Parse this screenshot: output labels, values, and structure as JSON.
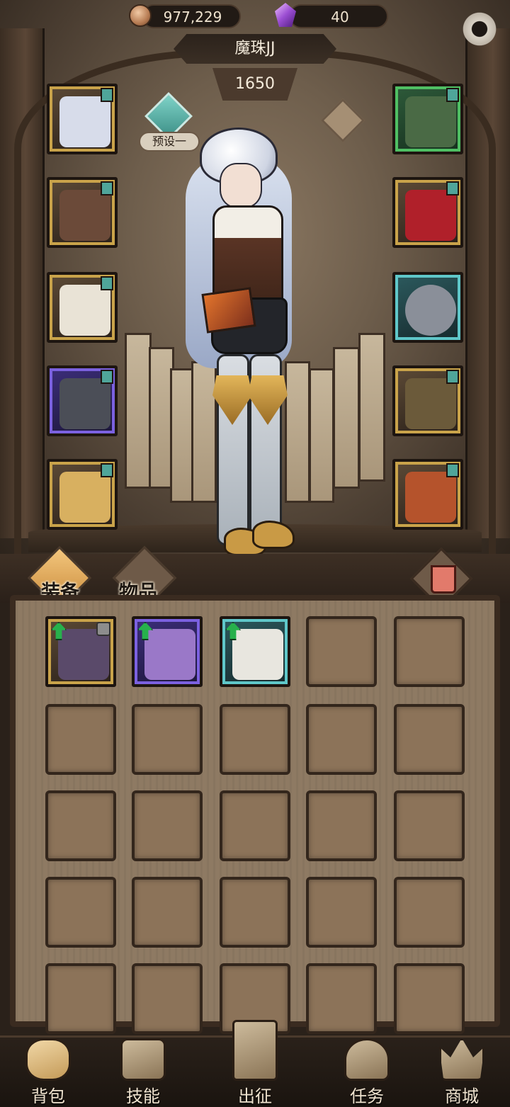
{
  "currency": {
    "copper": "977,229",
    "gems": "40"
  },
  "character": {
    "name": "魔珠JJ",
    "power": "1650",
    "preset_label": "预设一"
  },
  "equipment_left": [
    {
      "name": "hat",
      "rarity": "gold",
      "color": "#d7dcea"
    },
    {
      "name": "chest",
      "rarity": "gold",
      "color": "#6b4a39"
    },
    {
      "name": "gloves",
      "rarity": "gold",
      "color": "#e9e3d6"
    },
    {
      "name": "pants",
      "rarity": "purple",
      "color": "#4b4e57"
    },
    {
      "name": "boots",
      "rarity": "gold",
      "color": "#d8b060"
    }
  ],
  "equipment_right": [
    {
      "name": "necklace",
      "rarity": "green",
      "color": "#4a6a45"
    },
    {
      "name": "helmet",
      "rarity": "gold",
      "color": "#b0202a"
    },
    {
      "name": "ring",
      "rarity": "teal",
      "color": "#8a8f99"
    },
    {
      "name": "weapon",
      "rarity": "gold",
      "color": "#6b5a3a"
    },
    {
      "name": "book",
      "rarity": "gold",
      "color": "#b5532c"
    }
  ],
  "tabs": {
    "equipment": "装备",
    "items": "物品"
  },
  "inventory": {
    "items": [
      {
        "name": "cage-relic",
        "rarity": "gold",
        "upgradable": true,
        "locked": true,
        "color": "#5a4a6a"
      },
      {
        "name": "amethyst-amulet",
        "rarity": "purple",
        "upgradable": true,
        "locked": false,
        "color": "#9a78c8"
      },
      {
        "name": "white-shorts",
        "rarity": "teal",
        "upgradable": true,
        "locked": false,
        "color": "#e8e6df"
      }
    ]
  },
  "nav": [
    {
      "label": "背包",
      "icon": "backpack-icon",
      "active": true
    },
    {
      "label": "技能",
      "icon": "skill-card-icon",
      "active": false
    },
    {
      "label": "出征",
      "icon": "expedition-sword-icon",
      "active": false
    },
    {
      "label": "任务",
      "icon": "quest-hat-icon",
      "active": false
    },
    {
      "label": "商城",
      "icon": "shop-crown-icon",
      "active": false
    }
  ],
  "colors": {
    "accent_teal": "#5fc7c9",
    "gold_frame": "#c9a34a",
    "panel": "#8e7a63"
  }
}
